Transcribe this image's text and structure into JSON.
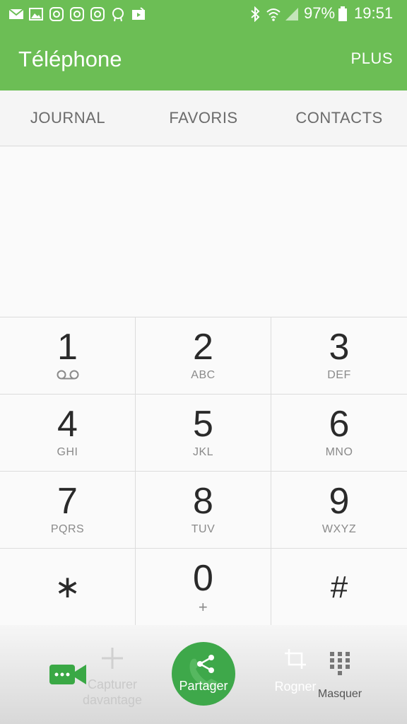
{
  "status_bar": {
    "battery": "97%",
    "time": "19:51",
    "icons": [
      "email-icon",
      "gallery-icon",
      "instagram-icon",
      "instagram-icon",
      "instagram-icon",
      "seal-icon",
      "video-icon",
      "bluetooth-icon",
      "wifi-icon",
      "signal-icon",
      "battery-icon"
    ]
  },
  "app_bar": {
    "title": "Téléphone",
    "more_label": "PLUS"
  },
  "tabs": [
    {
      "label": "JOURNAL"
    },
    {
      "label": "FAVORIS"
    },
    {
      "label": "CONTACTS"
    }
  ],
  "keypad": {
    "keys": [
      {
        "digit": "1",
        "letters": ""
      },
      {
        "digit": "2",
        "letters": "ABC"
      },
      {
        "digit": "3",
        "letters": "DEF"
      },
      {
        "digit": "4",
        "letters": "GHI"
      },
      {
        "digit": "5",
        "letters": "JKL"
      },
      {
        "digit": "6",
        "letters": "MNO"
      },
      {
        "digit": "7",
        "letters": "PQRS"
      },
      {
        "digit": "8",
        "letters": "TUV"
      },
      {
        "digit": "9",
        "letters": "WXYZ"
      },
      {
        "digit": "∗",
        "letters": ""
      },
      {
        "digit": "0",
        "letters": "+"
      },
      {
        "digit": "#",
        "letters": ""
      }
    ]
  },
  "bottom_bar": {
    "capture_label": "Capturer davantage",
    "share_label": "Partager",
    "crop_label": "Rogner",
    "hide_label": "Masquer"
  },
  "colors": {
    "accent": "#6cbe55",
    "call_green": "#3ea84a",
    "video_green": "#3aa845"
  }
}
